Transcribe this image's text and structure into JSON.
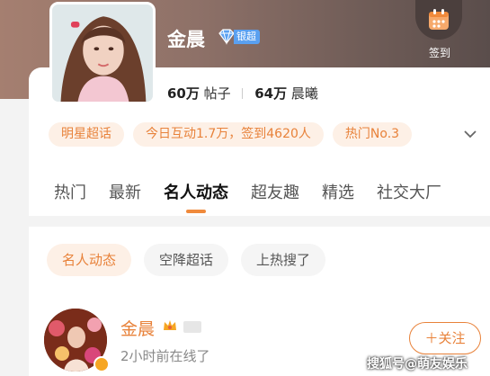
{
  "header": {
    "title": "金晨",
    "badge_label": "银超",
    "checkin_label": "签到",
    "stats": {
      "posts_value": "60万",
      "posts_label": "帖子",
      "fans_value": "64万",
      "fans_label": "晨曦"
    }
  },
  "tags": [
    "明星超话",
    "今日互动1.7万，签到4620人",
    "热门No.3"
  ],
  "tabs": [
    "热门",
    "最新",
    "名人动态",
    "超友趣",
    "精选",
    "社交大厂"
  ],
  "active_tab": "名人动态",
  "filters": [
    "名人动态",
    "空降超话",
    "上热搜了"
  ],
  "post": {
    "name": "金晨",
    "time": "2小时前在线了",
    "follow_label": "＋关注"
  },
  "watermark": "搜狐号@萌友娱乐",
  "colors": {
    "accent": "#e8823a",
    "accent_bg": "#fdf0e6",
    "badge_blue": "#5aa0f0"
  },
  "icons": {
    "checkin": "calendar-icon",
    "badge": "diamond-icon",
    "more": "chevron-down-icon",
    "crown": "crown-icon",
    "verified": "verified-badge-icon"
  }
}
